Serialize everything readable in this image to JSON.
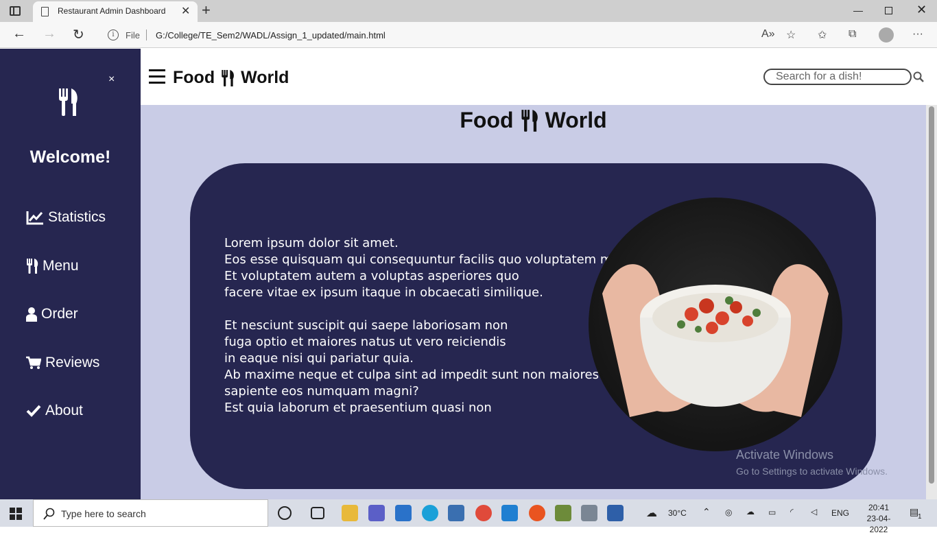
{
  "browser": {
    "tab_title": "Restaurant Admin Dashboard",
    "url_scheme_label": "File",
    "url": "G:/College/TE_Sem2/WADL/Assign_1_updated/main.html"
  },
  "sidebar": {
    "close_label": "×",
    "welcome": "Welcome!",
    "items": [
      {
        "label": "Statistics",
        "icon": "chart-line-icon"
      },
      {
        "label": "Menu",
        "icon": "utensils-icon"
      },
      {
        "label": "Order",
        "icon": "user-icon"
      },
      {
        "label": "Reviews",
        "icon": "cart-icon"
      },
      {
        "label": "About",
        "icon": "check-icon"
      }
    ]
  },
  "header": {
    "brand_left": "Food",
    "brand_right": "World",
    "search_placeholder": "Search for a dish!"
  },
  "main": {
    "title_left": "Food",
    "title_right": "World",
    "paragraph_1": [
      "Lorem ipsum dolor sit amet.",
      "Eos esse quisquam qui consequuntur facilis quo voluptatem modi.",
      "Et voluptatem autem a voluptas asperiores quo",
      "facere vitae ex ipsum itaque in obcaecati similique."
    ],
    "paragraph_2": [
      "Et nesciunt suscipit qui saepe laboriosam non",
      "fuga optio et maiores natus ut vero reiciendis",
      "in eaque nisi qui pariatur quia.",
      "Ab maxime neque et culpa sint ad impedit sunt non maiores",
      "sapiente eos numquam magni?",
      "Est quia laborum et praesentium quasi non"
    ]
  },
  "watermark": {
    "title": "Activate Windows",
    "subtitle": "Go to Settings to activate Windows."
  },
  "taskbar": {
    "search_placeholder": "Type here to search",
    "temperature": "30°C",
    "language": "ENG",
    "time": "20:41",
    "date": "23-04-2022",
    "notification_count": "1"
  },
  "colors": {
    "sidebar_bg": "#262650",
    "page_bg": "#c9cce6",
    "card_bg": "#262650"
  }
}
